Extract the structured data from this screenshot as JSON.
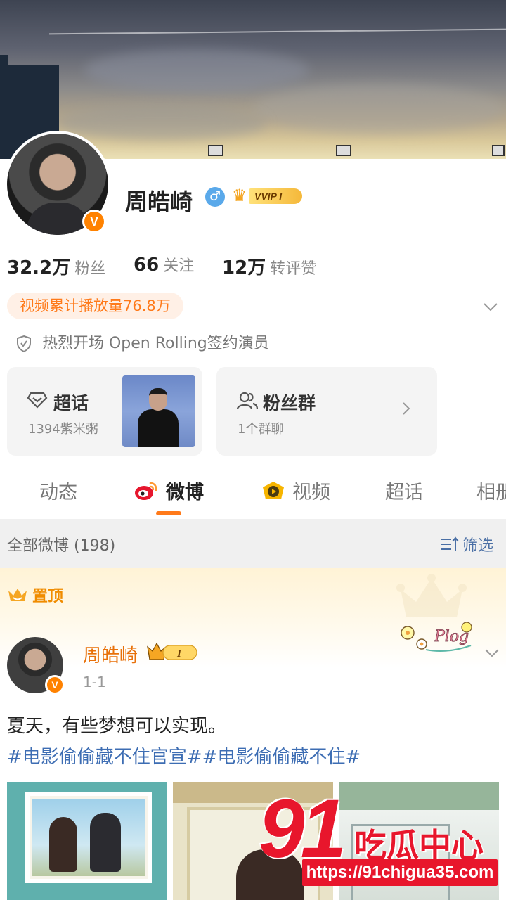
{
  "profile": {
    "name": "周皓崎",
    "verified_badge": "V",
    "vip_label": "VVIP I",
    "stats": [
      {
        "num": "32.2万",
        "label": "粉丝"
      },
      {
        "num": "66",
        "label": "关注"
      },
      {
        "num": "12万",
        "label": "转评赞"
      }
    ],
    "play_count": "视频累计播放量76.8万",
    "sign_line": "热烈开场 Open Rolling签约演员"
  },
  "cards": {
    "super_title": "超话",
    "super_sub": "1394紫米粥",
    "fans_title": "粉丝群",
    "fans_sub": "1个群聊"
  },
  "tabs": [
    "动态",
    "微博",
    "视频",
    "超话",
    "相册"
  ],
  "filter": {
    "left": "全部微博 (198)",
    "right": "筛选"
  },
  "post": {
    "pin_label": "置顶",
    "author": "周皓崎",
    "author_rank": "I",
    "time": "1-1",
    "text": "夏天，有些梦想可以实现。",
    "tags": "#电影偷偷藏不住官宣##电影偷偷藏不住#",
    "sticker_text": "Plog"
  },
  "watermark": {
    "big": "91",
    "cn": "吃瓜中心",
    "url": "https://91chigua35.com"
  },
  "colors": {
    "accent": "#ff7a1a",
    "verified": "#ff8200",
    "link": "#3d6db3",
    "watermark": "#e8162c"
  }
}
